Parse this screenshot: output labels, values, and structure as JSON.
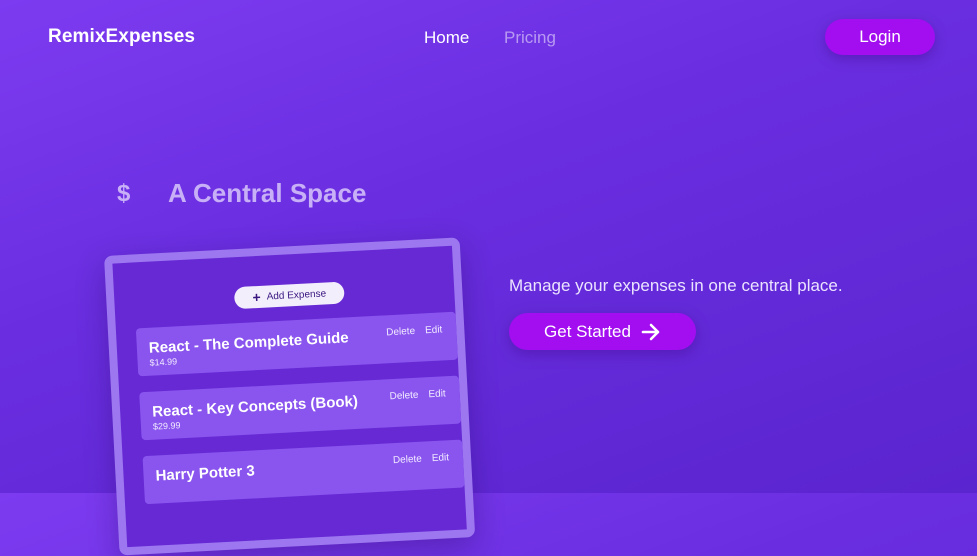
{
  "header": {
    "logo": "RemixExpenses",
    "nav": {
      "home": "Home",
      "pricing": "Pricing"
    },
    "login_label": "Login"
  },
  "hero": {
    "icon_glyph": "$",
    "headline": "A Central Space",
    "tagline": "Manage your expenses in one central place.",
    "cta_label": "Get Started"
  },
  "preview": {
    "add_label": "Add Expense",
    "items": [
      {
        "title": "React - The Complete Guide",
        "price": "$14.99",
        "delete": "Delete",
        "edit": "Edit"
      },
      {
        "title": "React - Key Concepts (Book)",
        "price": "$29.99",
        "delete": "Delete",
        "edit": "Edit"
      },
      {
        "title": "Harry Potter 3",
        "price": "",
        "delete": "Delete",
        "edit": "Edit"
      }
    ]
  },
  "colors": {
    "accent": "#a20ef0",
    "background_start": "#7d3bf0",
    "background_end": "#5a24cf",
    "muted_text": "#c8b0f7"
  }
}
